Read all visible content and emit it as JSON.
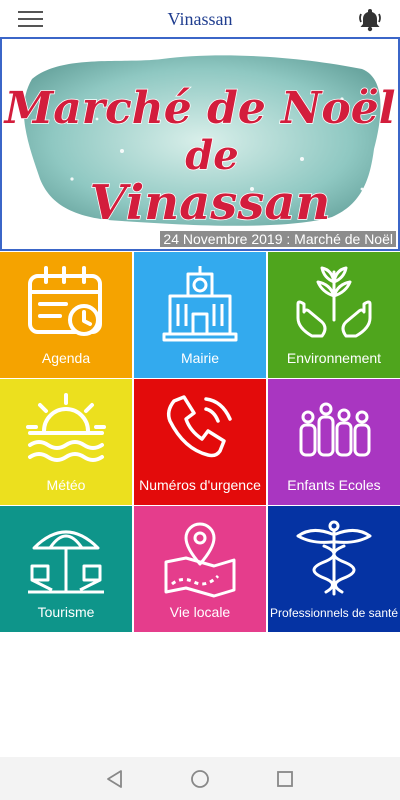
{
  "app": {
    "title": "Vinassan"
  },
  "banner": {
    "logo_line1": "Marché de Noël",
    "logo_line2": "de",
    "logo_line3": "Vinassan",
    "caption": "24 Novembre 2019 : Marché de Noël"
  },
  "tiles": [
    {
      "label": "Agenda",
      "icon": "calendar-icon",
      "color": "#f5a300"
    },
    {
      "label": "Mairie",
      "icon": "town-hall-icon",
      "color": "#33aaee"
    },
    {
      "label": "Environnement",
      "icon": "plant-hands-icon",
      "color": "#4fa51d"
    },
    {
      "label": "Météo",
      "icon": "sunset-icon",
      "color": "#ece01e"
    },
    {
      "label": "Numéros d'urgence",
      "icon": "phone-icon",
      "color": "#e30b0b"
    },
    {
      "label": "Enfants Ecoles",
      "icon": "children-icon",
      "color": "#a936c1"
    },
    {
      "label": "Tourisme",
      "icon": "beach-icon",
      "color": "#0e958a"
    },
    {
      "label": "Vie locale",
      "icon": "map-pin-icon",
      "color": "#e53d8c"
    },
    {
      "label": "Professionnels de santé",
      "icon": "caduceus-icon",
      "color": "#0533a3"
    }
  ]
}
